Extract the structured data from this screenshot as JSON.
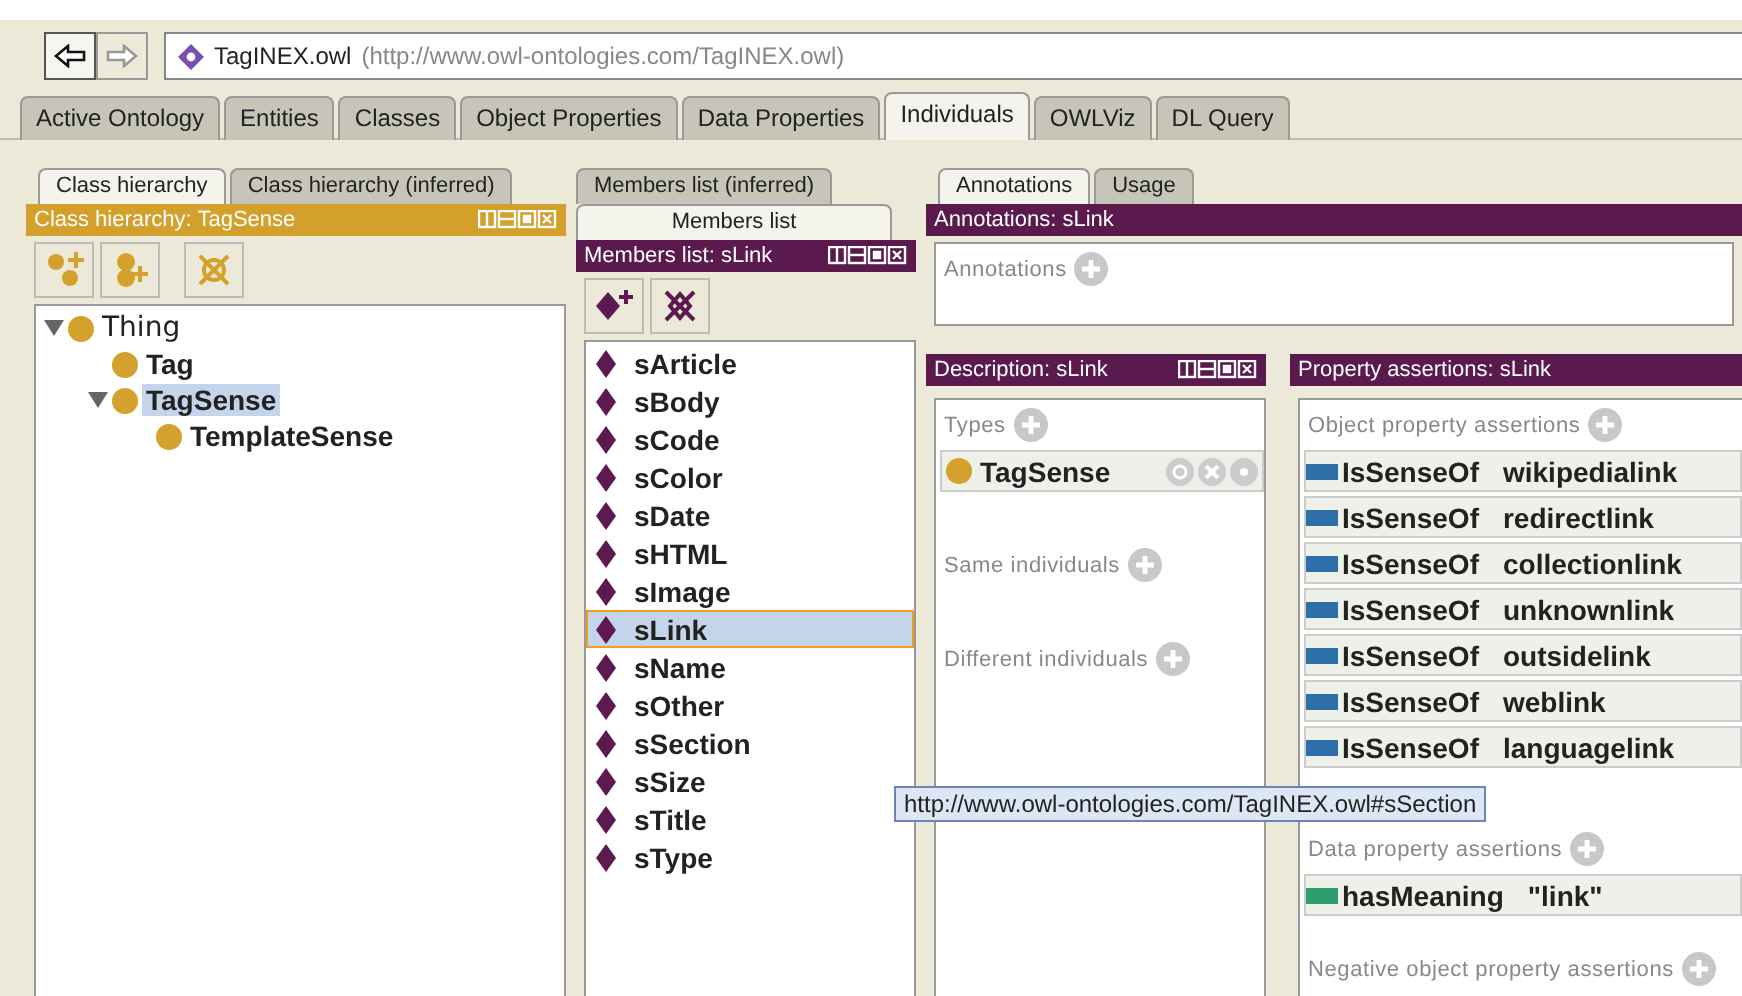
{
  "address": {
    "name": "TagINEX.owl",
    "iri": "(http://www.owl-ontologies.com/TagINEX.owl)"
  },
  "tabs": [
    {
      "label": "Active Ontology",
      "selected": false
    },
    {
      "label": "Entities",
      "selected": false
    },
    {
      "label": "Classes",
      "selected": false
    },
    {
      "label": "Object Properties",
      "selected": false
    },
    {
      "label": "Data Properties",
      "selected": false
    },
    {
      "label": "Individuals",
      "selected": true
    },
    {
      "label": "OWLViz",
      "selected": false
    },
    {
      "label": "DL Query",
      "selected": false
    }
  ],
  "class_panel": {
    "tabs": [
      {
        "label": "Class hierarchy",
        "selected": true
      },
      {
        "label": "Class hierarchy (inferred)",
        "selected": false
      }
    ],
    "title": "Class hierarchy: TagSense",
    "tree": [
      {
        "label": "Thing",
        "expanded": true,
        "selected": false,
        "children": [
          {
            "label": "Tag",
            "expanded": false,
            "selected": false
          },
          {
            "label": "TagSense",
            "expanded": true,
            "selected": true,
            "children": [
              {
                "label": "TemplateSense",
                "expanded": false,
                "selected": false
              }
            ]
          }
        ]
      }
    ]
  },
  "members_panel": {
    "tabs": [
      {
        "label": "Members list (inferred)",
        "selected": false
      },
      {
        "label": "Members list",
        "selected": true
      }
    ],
    "title": "Members list: sLink",
    "items": [
      {
        "label": "sArticle",
        "selected": false
      },
      {
        "label": "sBody",
        "selected": false
      },
      {
        "label": "sCode",
        "selected": false
      },
      {
        "label": "sColor",
        "selected": false
      },
      {
        "label": "sDate",
        "selected": false
      },
      {
        "label": "sHTML",
        "selected": false
      },
      {
        "label": "sImage",
        "selected": false
      },
      {
        "label": "sLink",
        "selected": true
      },
      {
        "label": "sName",
        "selected": false
      },
      {
        "label": "sOther",
        "selected": false
      },
      {
        "label": "sSection",
        "selected": false
      },
      {
        "label": "sSize",
        "selected": false
      },
      {
        "label": "sTitle",
        "selected": false
      },
      {
        "label": "sType",
        "selected": false
      }
    ]
  },
  "annotations_panel": {
    "tabs": [
      {
        "label": "Annotations",
        "selected": true
      },
      {
        "label": "Usage",
        "selected": false
      }
    ],
    "title": "Annotations: sLink",
    "section": "Annotations"
  },
  "description_panel": {
    "title": "Description: sLink",
    "types_label": "Types",
    "types": [
      {
        "label": "TagSense"
      }
    ],
    "sections": [
      "Same individuals",
      "Different individuals"
    ]
  },
  "property_panel": {
    "title": "Property assertions: sLink",
    "object_label": "Object property assertions",
    "object_assertions": [
      {
        "property": "IsSenseOf",
        "value": "wikipedialink"
      },
      {
        "property": "IsSenseOf",
        "value": "redirectlink"
      },
      {
        "property": "IsSenseOf",
        "value": "collectionlink"
      },
      {
        "property": "IsSenseOf",
        "value": "unknownlink"
      },
      {
        "property": "IsSenseOf",
        "value": "outsidelink"
      },
      {
        "property": "IsSenseOf",
        "value": "weblink"
      },
      {
        "property": "IsSenseOf",
        "value": "languagelink"
      }
    ],
    "data_label": "Data property assertions",
    "data_assertions": [
      {
        "property": "hasMeaning",
        "value": "\"link\""
      }
    ],
    "negative_label": "Negative object property assertions"
  },
  "tooltip": "http://www.owl-ontologies.com/TagINEX.owl#sSection"
}
